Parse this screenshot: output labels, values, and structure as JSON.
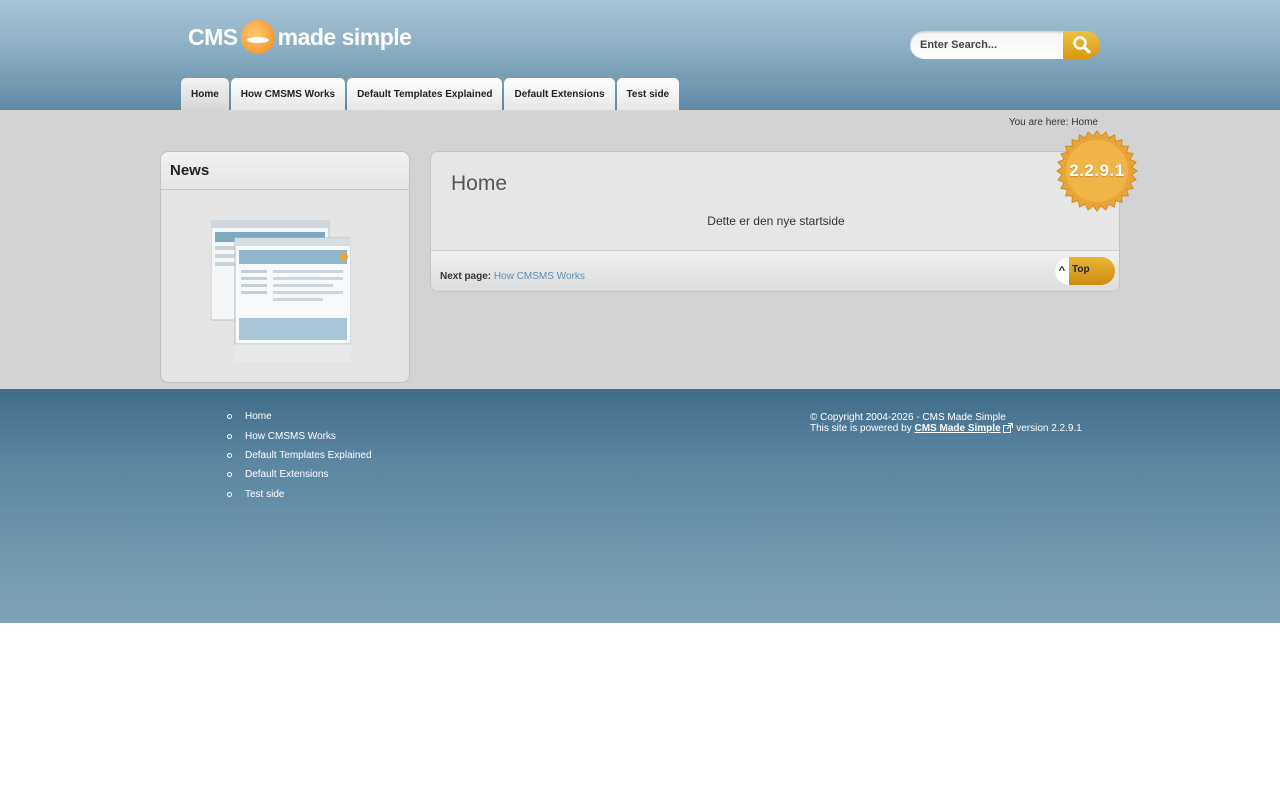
{
  "header": {
    "logo_text_left": "CMS",
    "logo_text_right": "made simple",
    "search": {
      "placeholder": "Enter Search..."
    }
  },
  "nav": {
    "tabs": [
      {
        "label": "Home",
        "active": true
      },
      {
        "label": "How CMSMS Works"
      },
      {
        "label": "Default Templates Explained"
      },
      {
        "label": "Default Extensions"
      },
      {
        "label": "Test side"
      }
    ]
  },
  "breadcrumb": {
    "prefix": "You are here:",
    "current": "Home"
  },
  "sidebar": {
    "title": "News"
  },
  "main": {
    "title": "Home",
    "text": "Dette er den nye startside",
    "next_label": "Next page:",
    "next_link": "How CMSMS Works",
    "top_caret": "^",
    "top_label": "Top"
  },
  "version_badge": "2.2.9.1",
  "footer": {
    "nav": [
      "Home",
      "How CMSMS Works",
      "Default Templates Explained",
      "Default Extensions",
      "Test side"
    ],
    "copyright": "© Copyright 2004-2026 - CMS Made Simple",
    "powered_prefix": "This site is powered by",
    "powered_link": "CMS Made Simple",
    "powered_suffix": "version 2.2.9.1"
  },
  "colors": {
    "accent": "#d89812",
    "header_top": "#a8c4d5",
    "footer": "#4f7b98",
    "link": "#5a8fb8"
  },
  "icons": {
    "search": "magnifier-icon",
    "external": "external-link-icon",
    "logo": "island-sun-icon"
  }
}
